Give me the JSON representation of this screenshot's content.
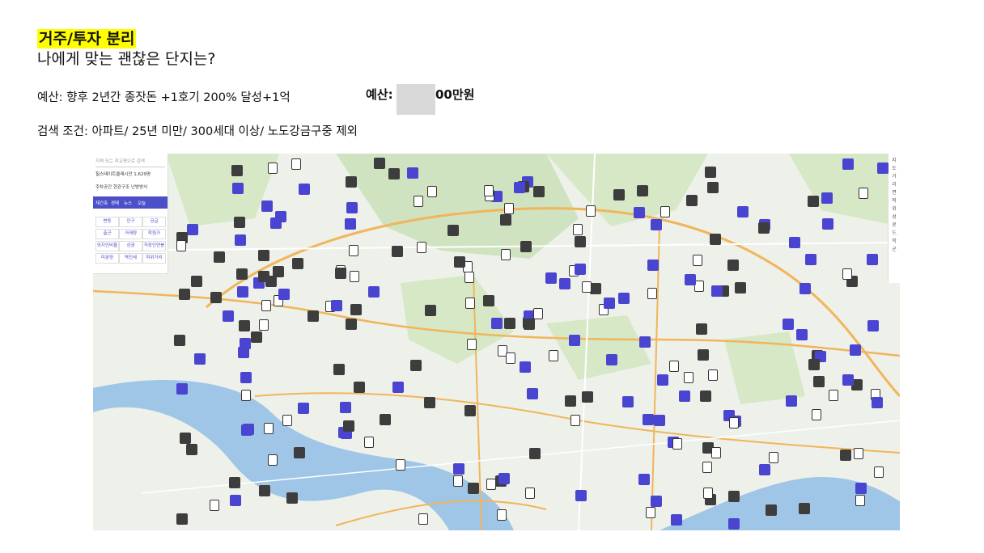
{
  "slide": {
    "title": "거주/투자 분리",
    "subtitle": "나에게 맞는 괜찮은 단지는?",
    "budget_line": "예산:  향후 2년간 종잣돈 +1호기 200% 달성+1억",
    "budget_bold_prefix": "예산:",
    "budget_bold_suffix": "00만원",
    "search_conditions": "검색 조건: 아파트/ 25년 미만/ 300세대 이상/ 노도강금구중 제외"
  },
  "map": {
    "panel": {
      "search_placeholder": "지역 또는 학교명으로 검색",
      "address": "힐스테이트클래시안  1,629명",
      "filters": "주차공간  현관구조  난방방식",
      "tabs": [
        "재건축",
        "경매",
        "뉴스",
        "오늘"
      ],
      "grid": [
        "변동",
        "인구",
        "공급",
        "출근",
        "거래량",
        "학원가",
        "외지인비율",
        "상권",
        "직장인연봉",
        "미분양",
        "역진세",
        "학위거리"
      ]
    },
    "sidebar_tools": [
      "지도",
      "거리",
      "면적",
      "위성",
      "로드",
      "학군"
    ],
    "colors": {
      "water": "#9fc6e6",
      "green": "#cfe3c0",
      "road": "#f1b55b",
      "pin_blue": "#4a45d1",
      "pin_dark": "#3d3d3d"
    }
  }
}
